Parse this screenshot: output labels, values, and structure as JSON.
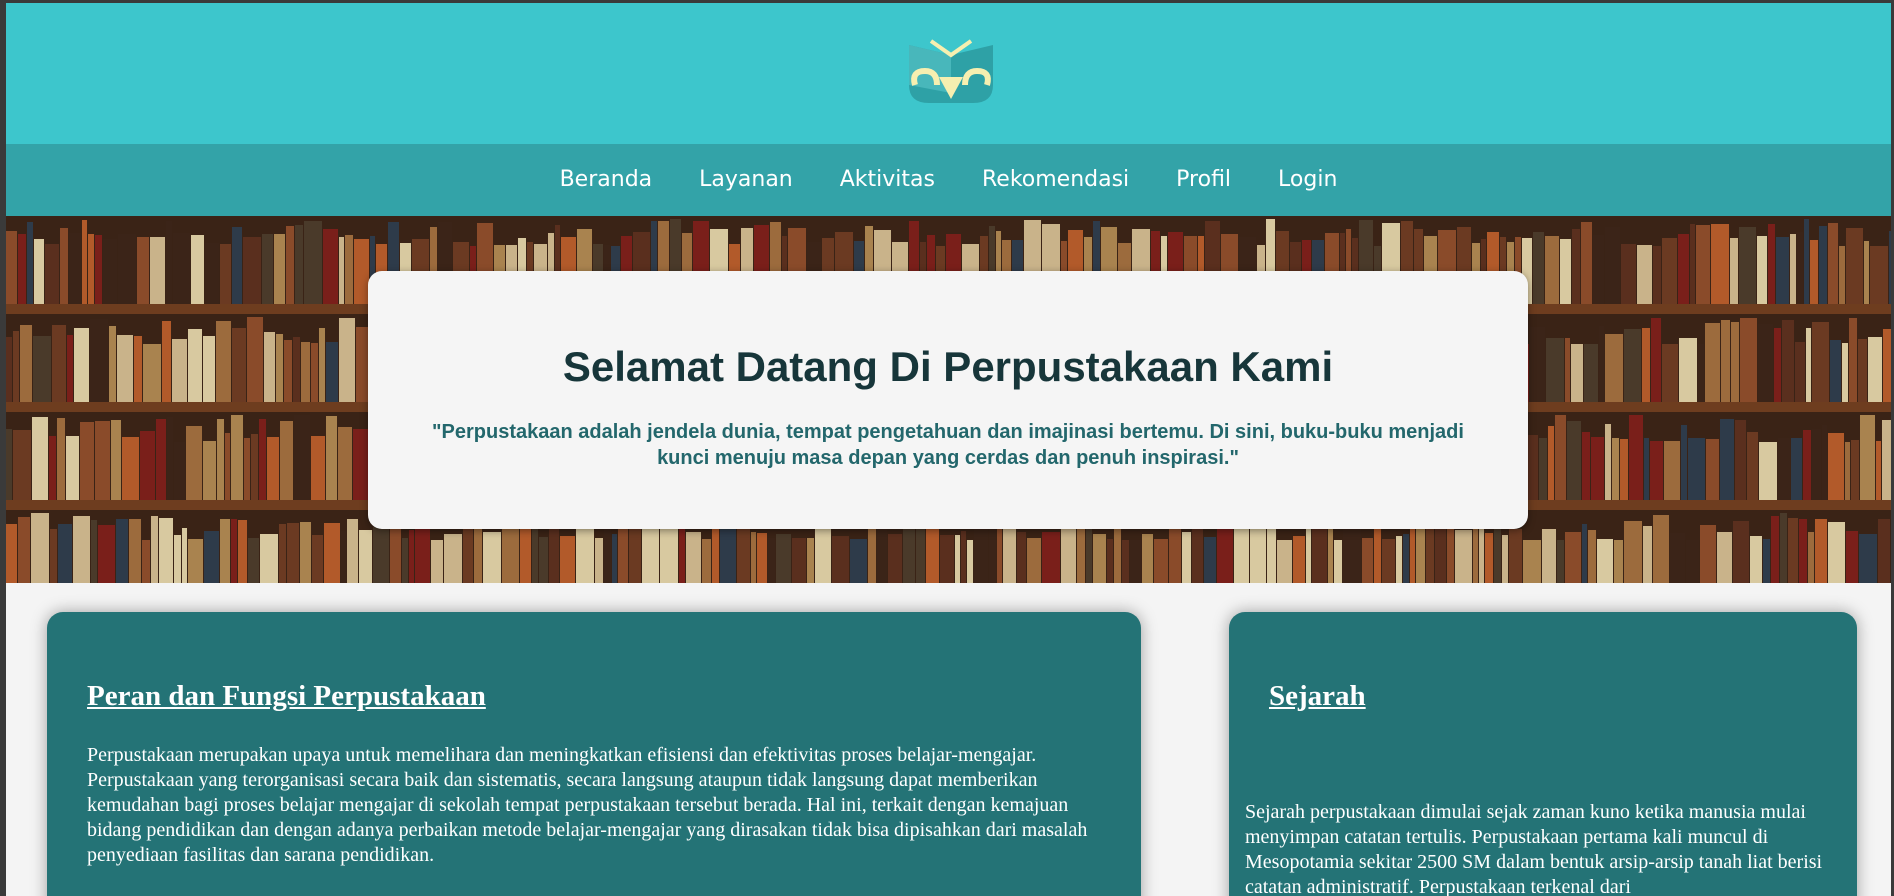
{
  "logo": {
    "icon": "owl-book-logo"
  },
  "nav": {
    "items": [
      "Beranda",
      "Layanan",
      "Aktivitas",
      "Rekomendasi",
      "Profil",
      "Login"
    ]
  },
  "hero": {
    "title": "Selamat Datang Di Perpustakaan Kami",
    "quote": "\"Perpustakaan adalah jendela dunia, tempat pengetahuan dan imajinasi bertemu. Di sini, buku-buku menjadi kunci menuju masa depan yang cerdas dan penuh inspirasi.\""
  },
  "cards": {
    "peran": {
      "title": "Peran dan Fungsi Perpustakaan",
      "body": "Perpustakaan merupakan upaya untuk memelihara dan meningkatkan efisiensi dan efektivitas proses belajar-mengajar. Perpustakaan yang terorganisasi secara baik dan sistematis, secara langsung ataupun tidak langsung dapat memberikan kemudahan bagi proses belajar mengajar di sekolah tempat perpustakaan tersebut berada. Hal ini, terkait dengan kemajuan bidang pendidikan dan dengan adanya perbaikan metode belajar-mengajar yang dirasakan tidak bisa dipisahkan dari masalah penyediaan fasilitas dan sarana pendidikan."
    },
    "sejarah": {
      "title": "Sejarah",
      "body": "Sejarah perpustakaan dimulai sejak zaman kuno ketika manusia mulai menyimpan catatan tertulis. Perpustakaan pertama kali muncul di Mesopotamia sekitar 2500 SM dalam bentuk arsip-arsip tanah liat berisi catatan administratif. Perpustakaan terkenal dari"
    }
  },
  "colors": {
    "header": "#3dc6cc",
    "nav": "#33a3a8",
    "card": "#247376",
    "title": "#17363a"
  }
}
